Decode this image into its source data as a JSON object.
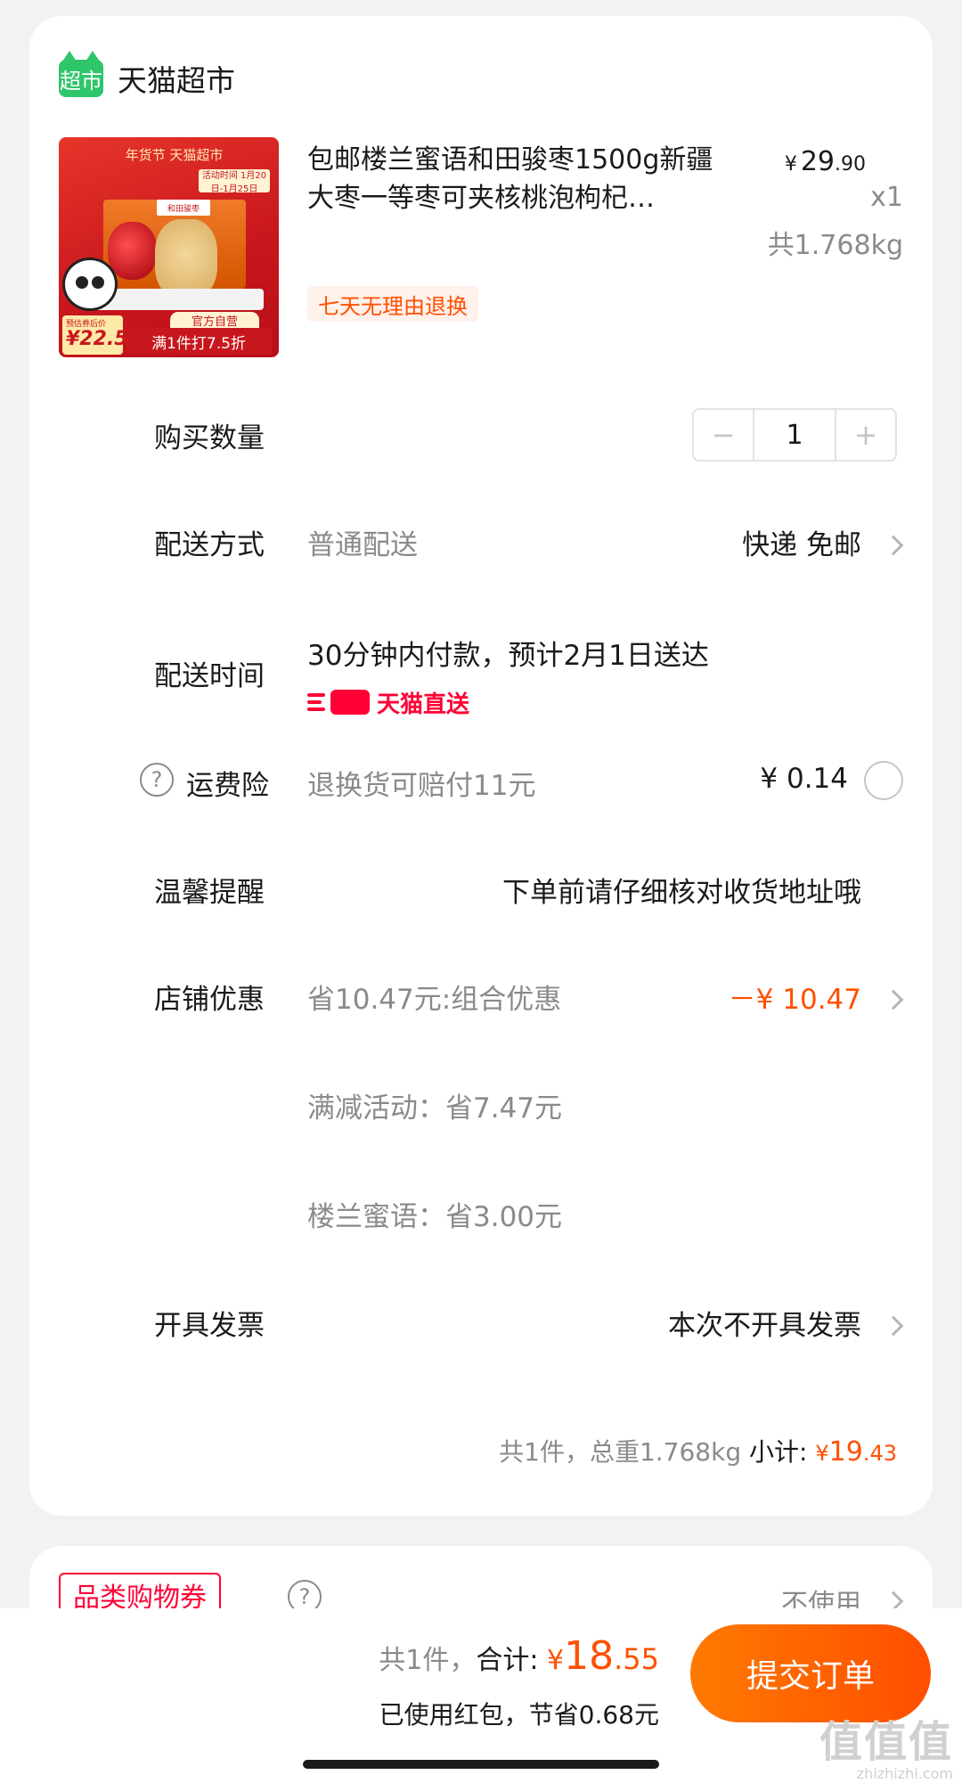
{
  "store": {
    "logo_text": "超市",
    "name": "天猫超市"
  },
  "product": {
    "image_texts": {
      "banner": "年货节 天猫超市",
      "activity_date": "活动时间 1月20日-1月25日",
      "box_label": "和田骏枣",
      "price_label": "预估券后价",
      "price": "¥22.5",
      "official": "官方自营",
      "discount": "满1件打7.5折"
    },
    "title": "包邮楼兰蜜语和田骏枣1500g新疆大枣一等枣可夹核桃泡枸杞…",
    "price_currency": "¥",
    "price_int": "29",
    "price_dec": ".90",
    "quantity": "x1",
    "weight": "共1.768kg",
    "return_tag": "七天无理由退换"
  },
  "purchase_qty": {
    "label": "购买数量",
    "minus": "−",
    "value": "1",
    "plus": "+"
  },
  "delivery_method": {
    "label": "配送方式",
    "value": "普通配送",
    "right": "快递 免邮"
  },
  "delivery_time": {
    "label": "配送时间",
    "value": "30分钟内付款，预计2月1日送达",
    "badge": "天猫直送"
  },
  "shipping_insurance": {
    "label": "运费险",
    "help": "?",
    "value": "退换货可赔付11元",
    "price": "¥ 0.14"
  },
  "reminder": {
    "label": "温馨提醒",
    "value": "下单前请仔细核对收货地址哦"
  },
  "store_discount": {
    "label": "店铺优惠",
    "value": "省10.47元:组合优惠",
    "amount": "－¥ 10.47",
    "detail_1": "满减活动：省7.47元",
    "detail_2": "楼兰蜜语：省3.00元"
  },
  "invoice": {
    "label": "开具发票",
    "value": "本次不开具发票"
  },
  "subtotal": {
    "summary": "共1件，总重1.768kg",
    "label": " 小计: ",
    "currency": "¥",
    "int": "19",
    "dec": ".43"
  },
  "coupon": {
    "label": "品类购物券",
    "help": "?",
    "status": "不使用"
  },
  "bottom": {
    "count": "共1件，",
    "total_label": "合计: ",
    "currency": "¥",
    "total_int": "18",
    "total_dec": ".55",
    "saving": "已使用红包，节省0.68元",
    "submit": "提交订单"
  },
  "watermark": {
    "main": "值值值",
    "sub": "zhizhizhi.com"
  },
  "colors": {
    "accent": "#ff5000",
    "tmall_red": "#ff0036",
    "tmall_green": "#2fc56b"
  }
}
